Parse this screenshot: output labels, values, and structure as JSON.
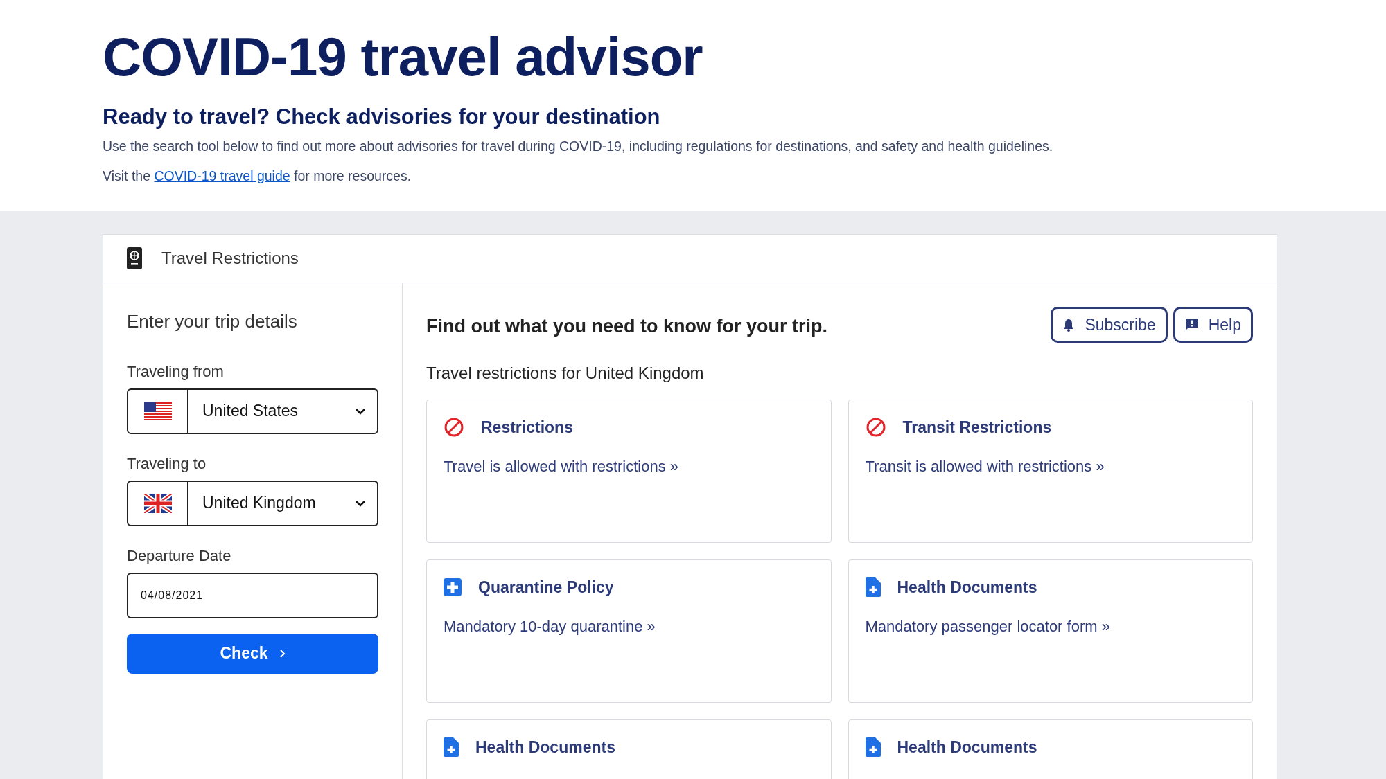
{
  "header": {
    "title": "COVID-19 travel advisor",
    "subtitle": "Ready to travel? Check advisories for your destination",
    "intro": "Use the search tool below to find out more about advisories for travel during COVID-19, including regulations for destinations, and safety and health guidelines.",
    "visit_before": "Visit the",
    "visit_link": "COVID-19 travel guide",
    "visit_after": "for more resources."
  },
  "panel": {
    "title": "Travel Restrictions"
  },
  "form": {
    "heading": "Enter your trip details",
    "fields": [
      {
        "kind": "country",
        "label": "Traveling from",
        "value": "United States"
      },
      {
        "kind": "country",
        "label": "Traveling to",
        "value": "United Kingdom"
      },
      {
        "kind": "date",
        "label": "Departure Date",
        "value": "04/08/2021"
      }
    ],
    "submit": "Check"
  },
  "results": {
    "heading": "Find out what you need to know for your trip.",
    "buttons": [
      {
        "label": "Subscribe"
      },
      {
        "label": "Help"
      }
    ],
    "subheading": "Travel restrictions for United Kingdom",
    "cards": [
      {
        "kind": "restriction",
        "title": "Restrictions",
        "text": "Travel is allowed with restrictions »"
      },
      {
        "kind": "restriction",
        "title": "Transit Restrictions",
        "text": "Transit is allowed with restrictions »"
      },
      {
        "kind": "quarantine",
        "title": "Quarantine Policy",
        "text": "Mandatory 10-day quarantine »"
      },
      {
        "kind": "document",
        "title": "Health Documents",
        "text": "Mandatory passenger locator form »"
      },
      {
        "kind": "document",
        "title": "Health Documents"
      },
      {
        "kind": "document",
        "title": "Health Documents"
      }
    ]
  }
}
